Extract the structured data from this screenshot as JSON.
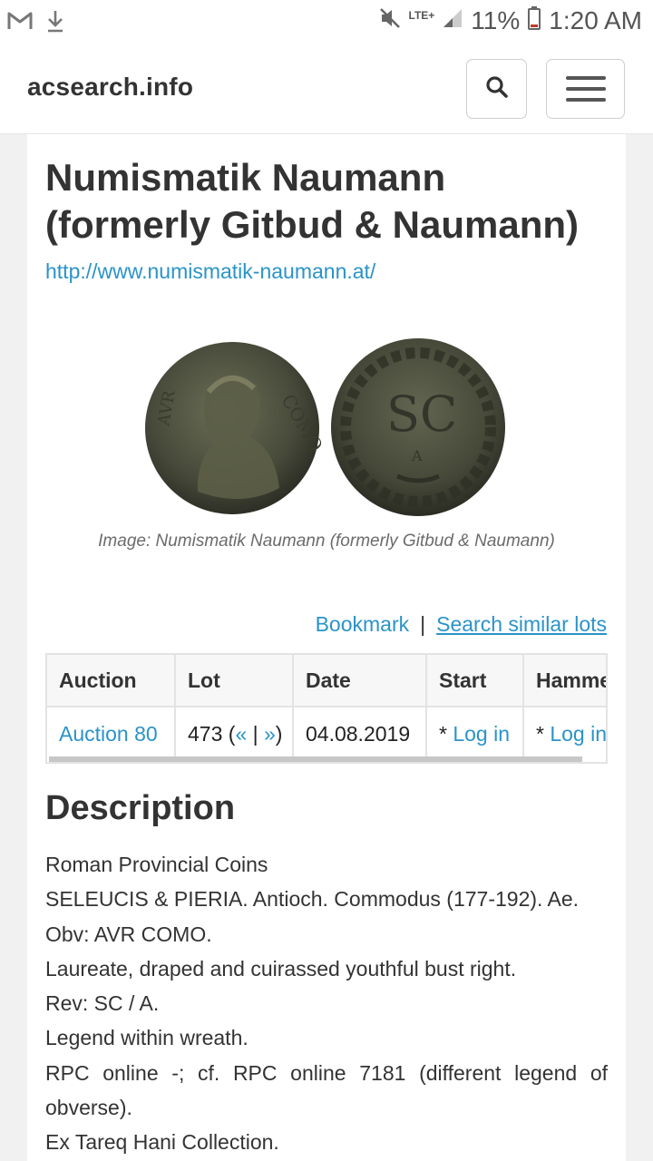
{
  "status_bar": {
    "network": "LTE+",
    "battery": "11%",
    "time": "1:20 AM"
  },
  "header": {
    "brand": "acsearch.info"
  },
  "page": {
    "title": "Numismatik Naumann (formerly Gitbud & Naumann)",
    "url": "http://www.numismatik-naumann.at/",
    "image_caption": "Image: Numismatik Naumann (formerly Gitbud & Naumann)"
  },
  "actions": {
    "bookmark": "Bookmark",
    "separator": "|",
    "search_similar": "Search similar lots"
  },
  "lot_table": {
    "headers": [
      "Auction",
      "Lot",
      "Date",
      "Start",
      "Hammer"
    ],
    "row": {
      "auction": "Auction 80",
      "lot_number": "473 (",
      "prev": "«",
      "lot_sep": " | ",
      "next": "»",
      "lot_close": ")",
      "date": "04.08.2019",
      "start_prefix": "* ",
      "start_link": "Log in",
      "hammer_prefix": "* ",
      "hammer_link": "Log in"
    }
  },
  "description": {
    "heading": "Description",
    "lines": [
      "Roman Provincial Coins",
      "SELEUCIS & PIERIA. Antioch. Commodus (177-192). Ae.",
      "Obv: AVR COMO.",
      "Laureate, draped and cuirassed youthful bust right.",
      "Rev: SC / A.",
      "Legend within wreath.",
      "RPC online -; cf. RPC online 7181 (different legend of obverse).",
      "Ex Tareq Hani Collection."
    ]
  }
}
